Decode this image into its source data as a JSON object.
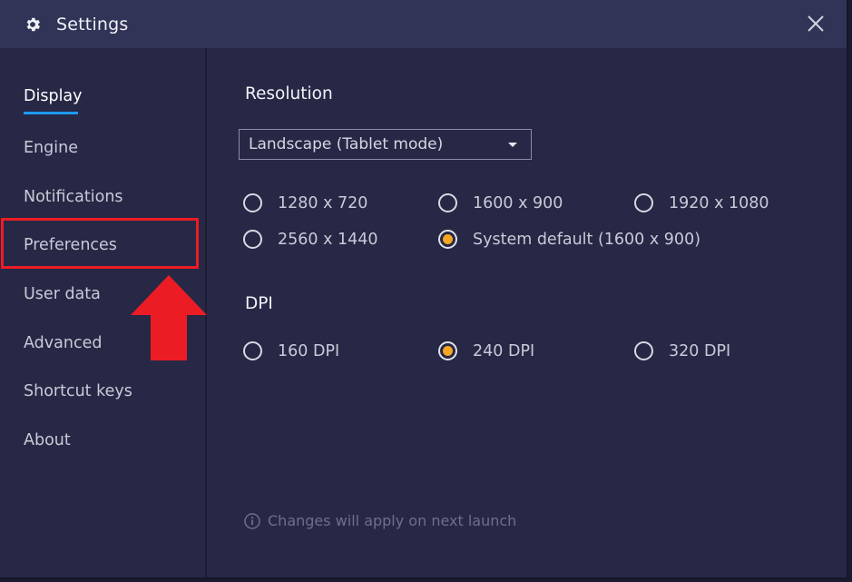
{
  "window": {
    "title": "Settings",
    "title_icon": "gear-icon",
    "close_icon": "close-icon"
  },
  "sidebar": {
    "items": [
      {
        "label": "Display",
        "active": true
      },
      {
        "label": "Engine",
        "active": false
      },
      {
        "label": "Notifications",
        "active": false
      },
      {
        "label": "Preferences",
        "active": false
      },
      {
        "label": "User data",
        "active": false
      },
      {
        "label": "Advanced",
        "active": false
      },
      {
        "label": "Shortcut keys",
        "active": false
      },
      {
        "label": "About",
        "active": false
      }
    ]
  },
  "resolution": {
    "title": "Resolution",
    "mode_value": "Landscape (Tablet mode)",
    "options": [
      {
        "label": "1280 x 720",
        "checked": false
      },
      {
        "label": "1600 x 900",
        "checked": false
      },
      {
        "label": "1920 x 1080",
        "checked": false
      },
      {
        "label": "2560 x 1440",
        "checked": false
      },
      {
        "label": "System default (1600 x 900)",
        "checked": true
      }
    ]
  },
  "dpi": {
    "title": "DPI",
    "options": [
      {
        "label": "160 DPI",
        "checked": false
      },
      {
        "label": "240 DPI",
        "checked": true
      },
      {
        "label": "320 DPI",
        "checked": false
      }
    ]
  },
  "footer": {
    "note": "Changes will apply on next launch",
    "icon": "info-icon"
  },
  "colors": {
    "background": "#262845",
    "titlebar": "#313456",
    "accent": "#1e9bff",
    "radio_selected": "#f5a623",
    "annotation_red": "#ec1c24"
  }
}
